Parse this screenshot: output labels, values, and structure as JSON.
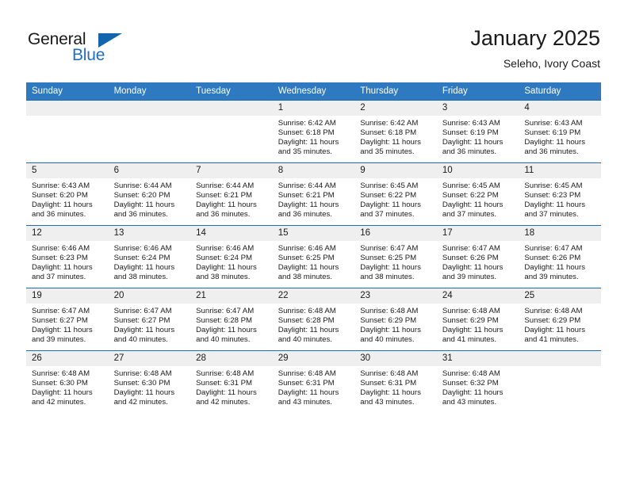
{
  "brand": {
    "name_part1": "General",
    "name_part2": "Blue",
    "triangle_color": "#1366ad",
    "blue_color": "#1f6fc4"
  },
  "header": {
    "title": "January 2025",
    "subtitle": "Seleho, Ivory Coast"
  },
  "theme": {
    "header_row_bg": "#2e79bf",
    "header_row_text": "#ffffff",
    "week_divider": "#1f6fb0",
    "date_strip_bg": "#efefef",
    "cell_bg": "#ffffff"
  },
  "weekdays": [
    {
      "label": "Sunday"
    },
    {
      "label": "Monday"
    },
    {
      "label": "Tuesday"
    },
    {
      "label": "Wednesday"
    },
    {
      "label": "Thursday"
    },
    {
      "label": "Friday"
    },
    {
      "label": "Saturday"
    }
  ],
  "weeks": [
    [
      {
        "empty": true
      },
      {
        "empty": true
      },
      {
        "empty": true
      },
      {
        "day": "1",
        "sunrise": "Sunrise: 6:42 AM",
        "sunset": "Sunset: 6:18 PM",
        "daylight1": "Daylight: 11 hours",
        "daylight2": "and 35 minutes."
      },
      {
        "day": "2",
        "sunrise": "Sunrise: 6:42 AM",
        "sunset": "Sunset: 6:18 PM",
        "daylight1": "Daylight: 11 hours",
        "daylight2": "and 35 minutes."
      },
      {
        "day": "3",
        "sunrise": "Sunrise: 6:43 AM",
        "sunset": "Sunset: 6:19 PM",
        "daylight1": "Daylight: 11 hours",
        "daylight2": "and 36 minutes."
      },
      {
        "day": "4",
        "sunrise": "Sunrise: 6:43 AM",
        "sunset": "Sunset: 6:19 PM",
        "daylight1": "Daylight: 11 hours",
        "daylight2": "and 36 minutes."
      }
    ],
    [
      {
        "day": "5",
        "sunrise": "Sunrise: 6:43 AM",
        "sunset": "Sunset: 6:20 PM",
        "daylight1": "Daylight: 11 hours",
        "daylight2": "and 36 minutes."
      },
      {
        "day": "6",
        "sunrise": "Sunrise: 6:44 AM",
        "sunset": "Sunset: 6:20 PM",
        "daylight1": "Daylight: 11 hours",
        "daylight2": "and 36 minutes."
      },
      {
        "day": "7",
        "sunrise": "Sunrise: 6:44 AM",
        "sunset": "Sunset: 6:21 PM",
        "daylight1": "Daylight: 11 hours",
        "daylight2": "and 36 minutes."
      },
      {
        "day": "8",
        "sunrise": "Sunrise: 6:44 AM",
        "sunset": "Sunset: 6:21 PM",
        "daylight1": "Daylight: 11 hours",
        "daylight2": "and 36 minutes."
      },
      {
        "day": "9",
        "sunrise": "Sunrise: 6:45 AM",
        "sunset": "Sunset: 6:22 PM",
        "daylight1": "Daylight: 11 hours",
        "daylight2": "and 37 minutes."
      },
      {
        "day": "10",
        "sunrise": "Sunrise: 6:45 AM",
        "sunset": "Sunset: 6:22 PM",
        "daylight1": "Daylight: 11 hours",
        "daylight2": "and 37 minutes."
      },
      {
        "day": "11",
        "sunrise": "Sunrise: 6:45 AM",
        "sunset": "Sunset: 6:23 PM",
        "daylight1": "Daylight: 11 hours",
        "daylight2": "and 37 minutes."
      }
    ],
    [
      {
        "day": "12",
        "sunrise": "Sunrise: 6:46 AM",
        "sunset": "Sunset: 6:23 PM",
        "daylight1": "Daylight: 11 hours",
        "daylight2": "and 37 minutes."
      },
      {
        "day": "13",
        "sunrise": "Sunrise: 6:46 AM",
        "sunset": "Sunset: 6:24 PM",
        "daylight1": "Daylight: 11 hours",
        "daylight2": "and 38 minutes."
      },
      {
        "day": "14",
        "sunrise": "Sunrise: 6:46 AM",
        "sunset": "Sunset: 6:24 PM",
        "daylight1": "Daylight: 11 hours",
        "daylight2": "and 38 minutes."
      },
      {
        "day": "15",
        "sunrise": "Sunrise: 6:46 AM",
        "sunset": "Sunset: 6:25 PM",
        "daylight1": "Daylight: 11 hours",
        "daylight2": "and 38 minutes."
      },
      {
        "day": "16",
        "sunrise": "Sunrise: 6:47 AM",
        "sunset": "Sunset: 6:25 PM",
        "daylight1": "Daylight: 11 hours",
        "daylight2": "and 38 minutes."
      },
      {
        "day": "17",
        "sunrise": "Sunrise: 6:47 AM",
        "sunset": "Sunset: 6:26 PM",
        "daylight1": "Daylight: 11 hours",
        "daylight2": "and 39 minutes."
      },
      {
        "day": "18",
        "sunrise": "Sunrise: 6:47 AM",
        "sunset": "Sunset: 6:26 PM",
        "daylight1": "Daylight: 11 hours",
        "daylight2": "and 39 minutes."
      }
    ],
    [
      {
        "day": "19",
        "sunrise": "Sunrise: 6:47 AM",
        "sunset": "Sunset: 6:27 PM",
        "daylight1": "Daylight: 11 hours",
        "daylight2": "and 39 minutes."
      },
      {
        "day": "20",
        "sunrise": "Sunrise: 6:47 AM",
        "sunset": "Sunset: 6:27 PM",
        "daylight1": "Daylight: 11 hours",
        "daylight2": "and 40 minutes."
      },
      {
        "day": "21",
        "sunrise": "Sunrise: 6:47 AM",
        "sunset": "Sunset: 6:28 PM",
        "daylight1": "Daylight: 11 hours",
        "daylight2": "and 40 minutes."
      },
      {
        "day": "22",
        "sunrise": "Sunrise: 6:48 AM",
        "sunset": "Sunset: 6:28 PM",
        "daylight1": "Daylight: 11 hours",
        "daylight2": "and 40 minutes."
      },
      {
        "day": "23",
        "sunrise": "Sunrise: 6:48 AM",
        "sunset": "Sunset: 6:29 PM",
        "daylight1": "Daylight: 11 hours",
        "daylight2": "and 40 minutes."
      },
      {
        "day": "24",
        "sunrise": "Sunrise: 6:48 AM",
        "sunset": "Sunset: 6:29 PM",
        "daylight1": "Daylight: 11 hours",
        "daylight2": "and 41 minutes."
      },
      {
        "day": "25",
        "sunrise": "Sunrise: 6:48 AM",
        "sunset": "Sunset: 6:29 PM",
        "daylight1": "Daylight: 11 hours",
        "daylight2": "and 41 minutes."
      }
    ],
    [
      {
        "day": "26",
        "sunrise": "Sunrise: 6:48 AM",
        "sunset": "Sunset: 6:30 PM",
        "daylight1": "Daylight: 11 hours",
        "daylight2": "and 42 minutes."
      },
      {
        "day": "27",
        "sunrise": "Sunrise: 6:48 AM",
        "sunset": "Sunset: 6:30 PM",
        "daylight1": "Daylight: 11 hours",
        "daylight2": "and 42 minutes."
      },
      {
        "day": "28",
        "sunrise": "Sunrise: 6:48 AM",
        "sunset": "Sunset: 6:31 PM",
        "daylight1": "Daylight: 11 hours",
        "daylight2": "and 42 minutes."
      },
      {
        "day": "29",
        "sunrise": "Sunrise: 6:48 AM",
        "sunset": "Sunset: 6:31 PM",
        "daylight1": "Daylight: 11 hours",
        "daylight2": "and 43 minutes."
      },
      {
        "day": "30",
        "sunrise": "Sunrise: 6:48 AM",
        "sunset": "Sunset: 6:31 PM",
        "daylight1": "Daylight: 11 hours",
        "daylight2": "and 43 minutes."
      },
      {
        "day": "31",
        "sunrise": "Sunrise: 6:48 AM",
        "sunset": "Sunset: 6:32 PM",
        "daylight1": "Daylight: 11 hours",
        "daylight2": "and 43 minutes."
      },
      {
        "empty": true
      }
    ]
  ]
}
